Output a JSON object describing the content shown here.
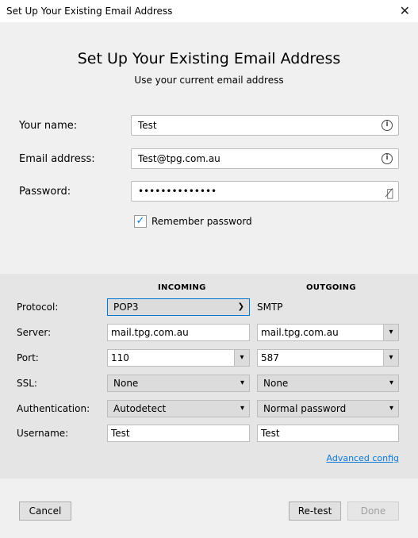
{
  "window": {
    "title": "Set Up Your Existing Email Address"
  },
  "header": {
    "title": "Set Up Your Existing Email Address",
    "subtitle": "Use your current email address"
  },
  "form": {
    "name": {
      "label": "Your name:",
      "value": "Test"
    },
    "email": {
      "label": "Email address:",
      "value": "Test@tpg.com.au"
    },
    "password": {
      "label": "Password:",
      "value": "••••••••••••••"
    },
    "remember": {
      "label": "Remember password",
      "checked": true
    }
  },
  "server": {
    "incoming_header": "INCOMING",
    "outgoing_header": "OUTGOING",
    "rows": {
      "protocol": {
        "label": "Protocol:",
        "incoming": "POP3",
        "outgoing": "SMTP"
      },
      "server": {
        "label": "Server:",
        "incoming": "mail.tpg.com.au",
        "outgoing": "mail.tpg.com.au"
      },
      "port": {
        "label": "Port:",
        "incoming": "110",
        "outgoing": "587"
      },
      "ssl": {
        "label": "SSL:",
        "incoming": "None",
        "outgoing": "None"
      },
      "auth": {
        "label": "Authentication:",
        "incoming": "Autodetect",
        "outgoing": "Normal password"
      },
      "username": {
        "label": "Username:",
        "incoming": "Test",
        "outgoing": "Test"
      }
    },
    "advanced": "Advanced config"
  },
  "buttons": {
    "cancel": "Cancel",
    "retest": "Re-test",
    "done": "Done"
  },
  "colors": {
    "accent": "#0078d7",
    "link": "#0a78d8"
  }
}
